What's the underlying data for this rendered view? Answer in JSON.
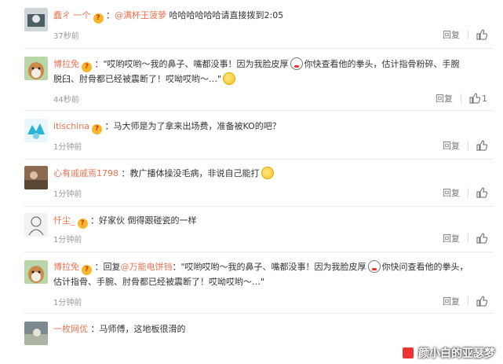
{
  "reply_label": "回复",
  "comments": [
    {
      "user": "蠢ㄔ 一个",
      "badge": "?",
      "mention": "@满杯王菠萝",
      "text": "哈哈哈哈哈哈请直接拨到2:05",
      "time": "37秒前",
      "likes": ""
    },
    {
      "user": "博拉免",
      "badge": "?",
      "text_a": "：\"哎哟哎哟～我的鼻子、嘴都没事！因为我脸皮厚",
      "text_b": "你快查看他的拳头，估计指骨粉碎、手腕",
      "text_c": "脱臼、肘骨都已经被震断了！哎呦哎哟～…\"",
      "time": "44秒前",
      "likes": "1"
    },
    {
      "user": "itischina",
      "badge": "?",
      "text": "：马大师是为了拿来出场费，准备被KO的吧？",
      "time": "1分钟前",
      "likes": ""
    },
    {
      "user": "心有戚戚焉1798",
      "text": "：教广播体操没毛病，非说自己能打",
      "time": "1分钟前",
      "likes": ""
    },
    {
      "user": "忏尘_",
      "badge": "?",
      "text": "：好家伙 倒得跟碰瓷的一样",
      "time": "1分钟前",
      "likes": ""
    },
    {
      "user": "博拉免",
      "badge": "?",
      "reply_prefix": "：回复",
      "mention": "@万能电饼铛",
      "text_a": "：\"哎哟哎哟～我的鼻子、嘴都没事！因为我脸皮厚",
      "text_b": "你快问查看他的拳头，",
      "text_c": "估计指骨、手腕、肘骨都已经被震断了！哎呦哎哟～…\"",
      "time": "1分钟前",
      "likes": ""
    },
    {
      "user": "一枚网优",
      "text": "：马师傅，这地板很滑的",
      "time": "",
      "likes": ""
    }
  ],
  "watermark": "颜小白的亚瑟梦",
  "colors": {
    "username": "#eb7350",
    "time": "#999999",
    "badge": "#f8b62d"
  }
}
